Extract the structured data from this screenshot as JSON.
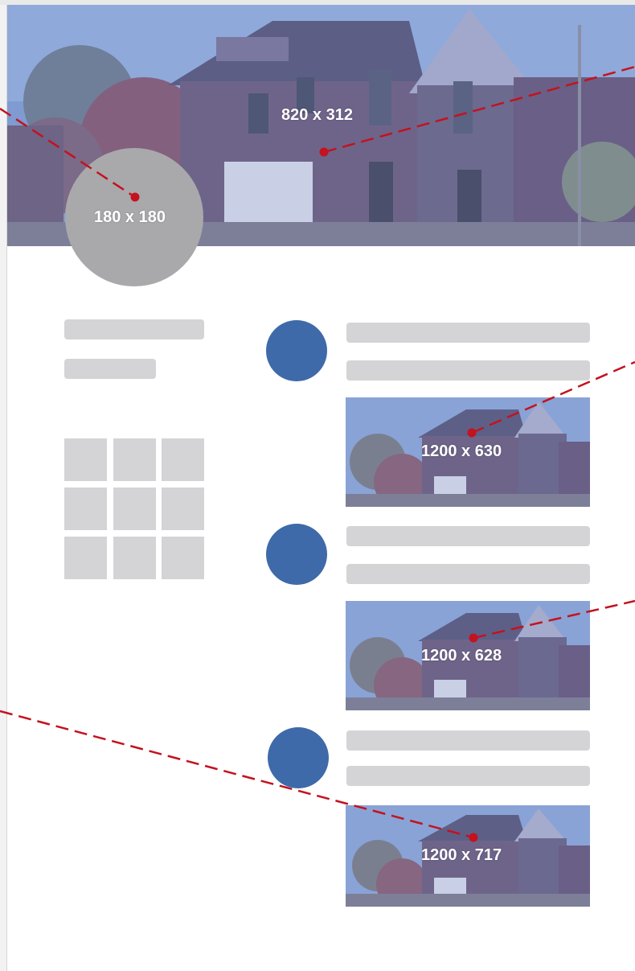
{
  "colors": {
    "placeholder_gray": "#d4d4d6",
    "avatar_gray": "#a9a9ab",
    "accent_blue": "#3f6aa9",
    "marker_red": "#c4121f",
    "photo_tint": "#5b7ab8"
  },
  "cover": {
    "size_label": "820 x 312"
  },
  "profile_picture": {
    "size_label": "180 x 180"
  },
  "posts": [
    {
      "image_size_label": "1200 x 630"
    },
    {
      "image_size_label": "1200 x 628"
    },
    {
      "image_size_label": "1200 x 717"
    }
  ],
  "icons": {
    "marker": "red-dot-marker",
    "leader_line": "dashed-red-line"
  }
}
